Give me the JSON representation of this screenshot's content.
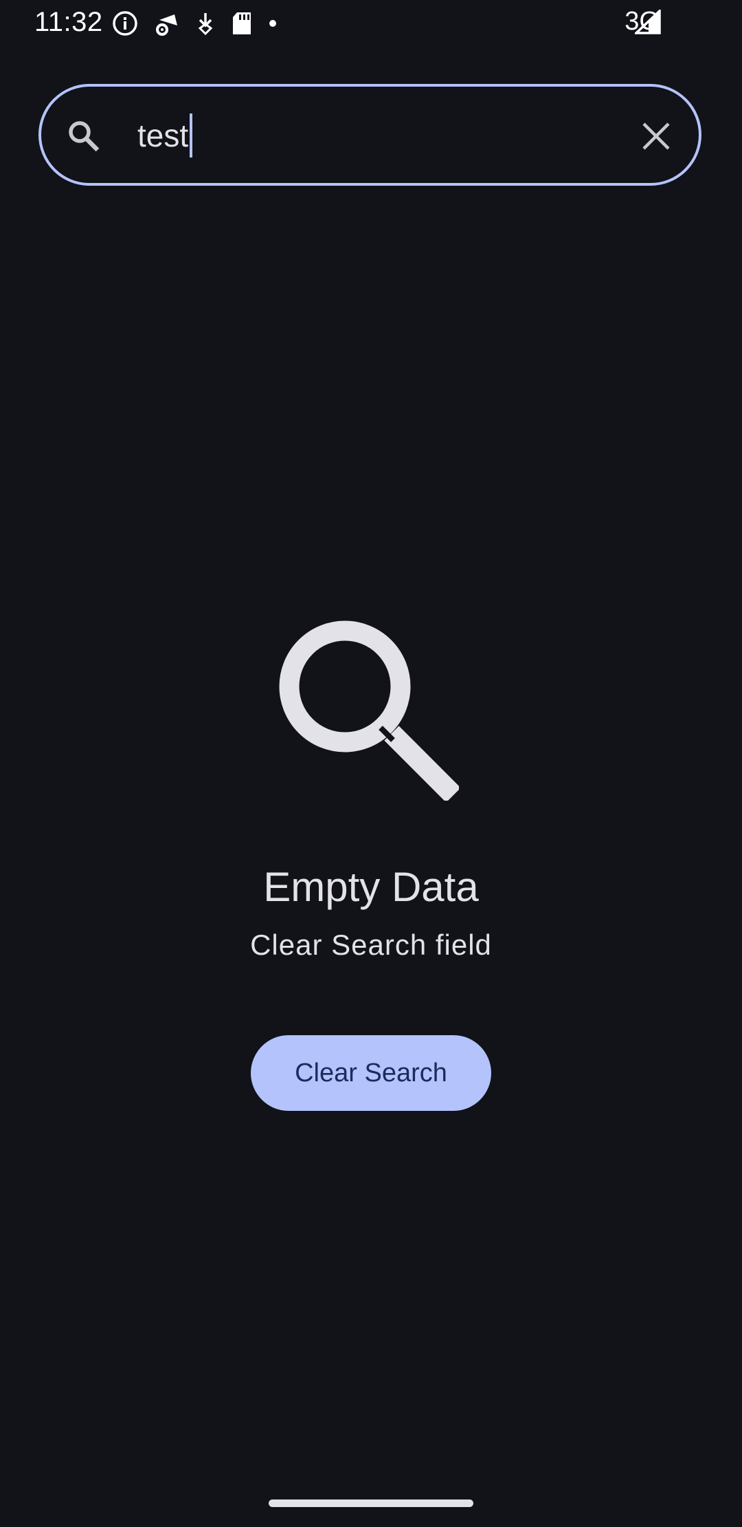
{
  "status_bar": {
    "time": "11:32",
    "network": "3G",
    "icons_left": [
      "info-icon",
      "wifi-settings-icon",
      "download-icon",
      "sd-card-icon",
      "dot-icon"
    ],
    "icons_right": [
      "signal-icon"
    ]
  },
  "search": {
    "value": "test",
    "leading_icon": "search-icon",
    "trailing_icon": "close-icon"
  },
  "empty_state": {
    "icon": "search-icon",
    "title": "Empty Data",
    "subtitle": "Clear Search field",
    "button_label": "Clear Search"
  },
  "colors": {
    "background": "#111319",
    "accent": "#b4c3fb",
    "on_accent": "#1c2a5e",
    "text": "#e3e2e8"
  }
}
